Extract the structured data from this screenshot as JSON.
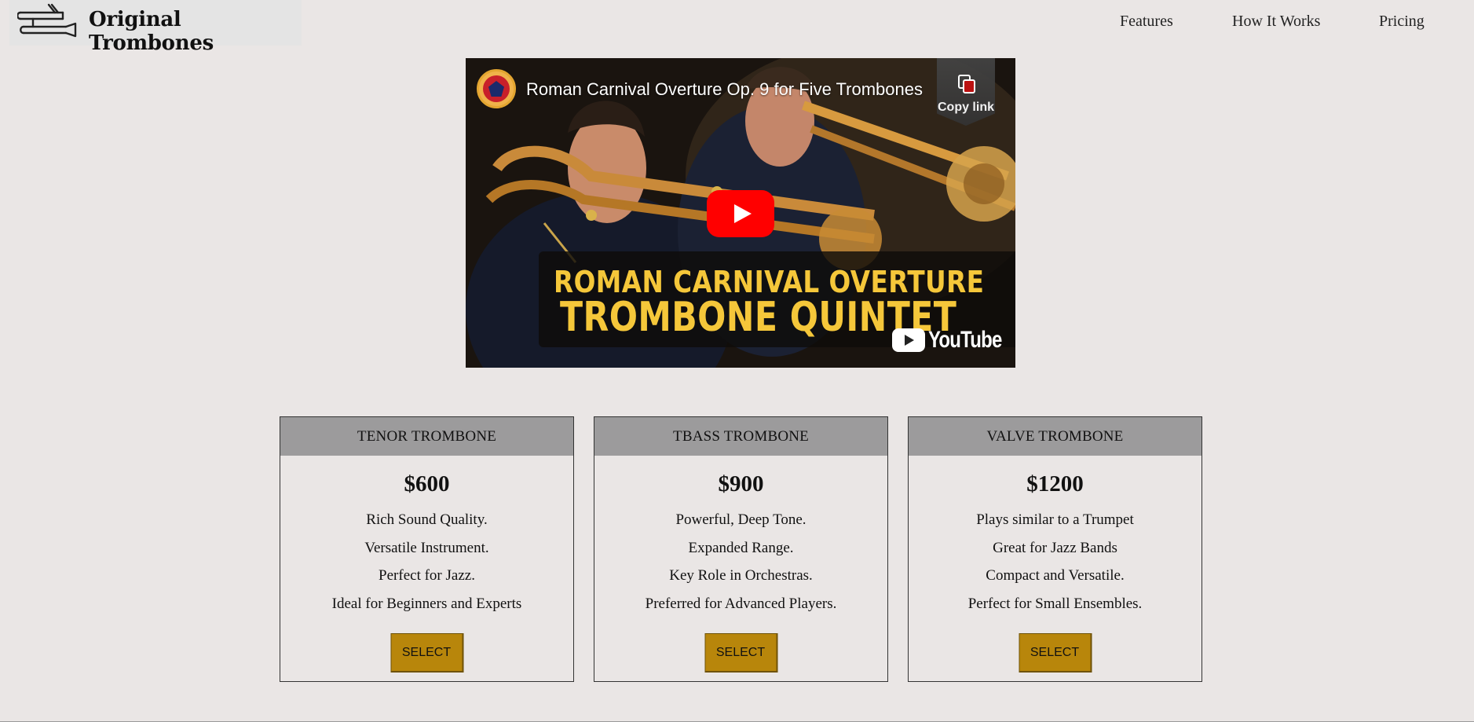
{
  "header": {
    "brand": "Original Trombones",
    "logo_icon": "trombone-icon",
    "nav": [
      {
        "label": "Features"
      },
      {
        "label": "How It Works"
      },
      {
        "label": "Pricing"
      }
    ]
  },
  "video": {
    "title": "Roman Carnival Overture Op. 9 for Five Trombones",
    "copy_link_label": "Copy link",
    "caption_line1": "ROMAN CARNIVAL OVERTURE",
    "caption_line2": "TROMBONE QUINTET",
    "platform": "YouTube",
    "play_icon": "play-icon"
  },
  "plans": [
    {
      "name": "TENOR TROMBONE",
      "price": "$600",
      "features": [
        "Rich Sound Quality.",
        "Versatile Instrument.",
        "Perfect for Jazz.",
        "Ideal for Beginners and Experts"
      ],
      "button": "SELECT"
    },
    {
      "name": "TBASS TROMBONE",
      "price": "$900",
      "features": [
        "Powerful, Deep Tone.",
        "Expanded Range.",
        "Key Role in Orchestras.",
        "Preferred for Advanced Players."
      ],
      "button": "SELECT"
    },
    {
      "name": "VALVE TROMBONE",
      "price": "$1200",
      "features": [
        "Plays similar to a Trumpet",
        "Great for Jazz Bands",
        "Compact and Versatile.",
        "Perfect for Small Ensembles."
      ],
      "button": "SELECT"
    }
  ],
  "colors": {
    "page_bg": "#eae6e5",
    "card_header": "#9c9b9c",
    "button": "#b8860b",
    "caption_text": "#f5c73a",
    "play_button": "#ff0000"
  }
}
